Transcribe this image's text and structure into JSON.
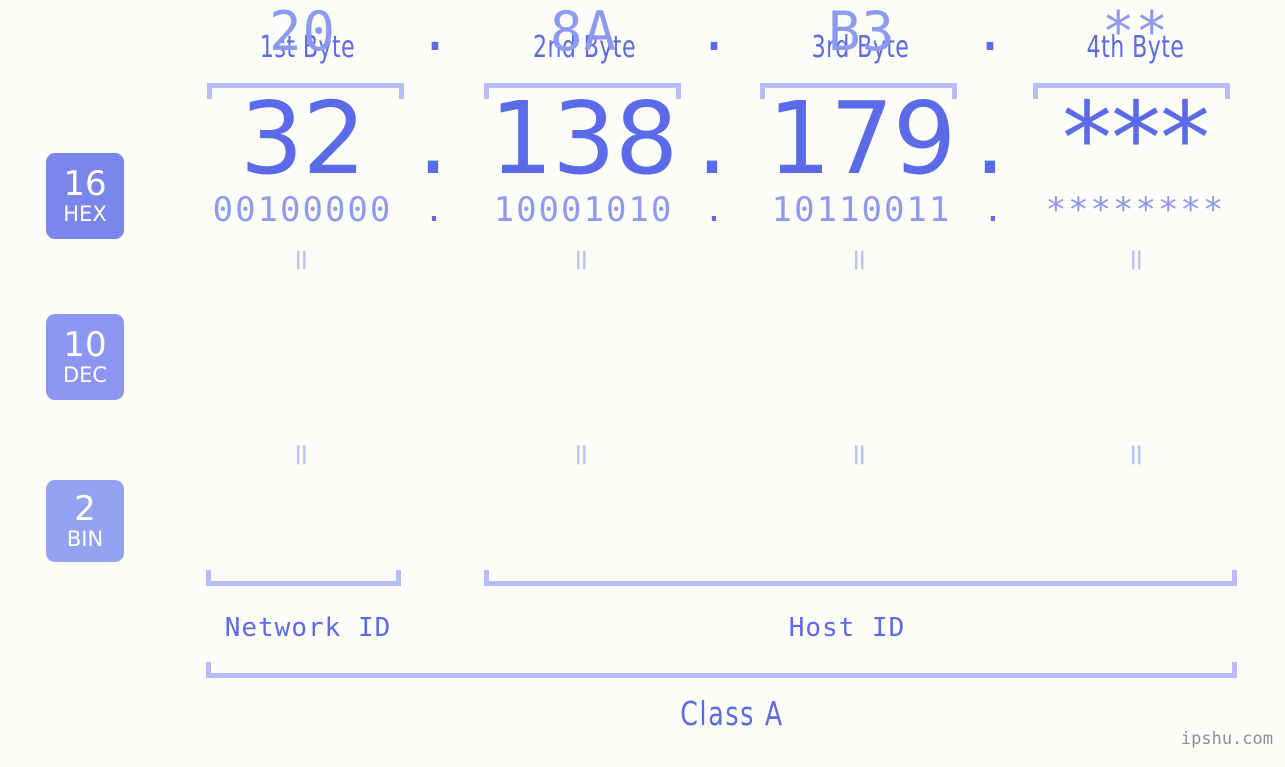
{
  "meta": {
    "watermark": "ipshu.com",
    "background_color": "#fcfdf8",
    "accent_color": "#5a6ae8",
    "light_accent_color": "#8e9af2",
    "bracket_color": "#b4bdf8"
  },
  "byte_headers": [
    {
      "label": "1st Byte"
    },
    {
      "label": "2nd Byte"
    },
    {
      "label": "3rd Byte"
    },
    {
      "label": "4th Byte"
    }
  ],
  "bases": [
    {
      "id": "hex",
      "number": "16",
      "name": "HEX",
      "color": "#7b86ec"
    },
    {
      "id": "dec",
      "number": "10",
      "name": "DEC",
      "color": "#8c96f0"
    },
    {
      "id": "bin",
      "number": "2",
      "name": "BIN",
      "color": "#93a3f2"
    }
  ],
  "rows": {
    "hex": {
      "values": [
        "20",
        "8A",
        "B3",
        "**"
      ],
      "separator": "."
    },
    "dec": {
      "values": [
        "32",
        "138",
        "179",
        "***"
      ],
      "separator": "."
    },
    "bin": {
      "values": [
        "00100000",
        "10001010",
        "10110011",
        "********"
      ],
      "separator": "."
    }
  },
  "connectors": {
    "symbol": "=",
    "rows": 2,
    "per_row": 4
  },
  "sections": [
    {
      "id": "network-id",
      "label": "Network ID"
    },
    {
      "id": "host-id",
      "label": "Host ID"
    }
  ],
  "class": {
    "label": "Class A"
  }
}
